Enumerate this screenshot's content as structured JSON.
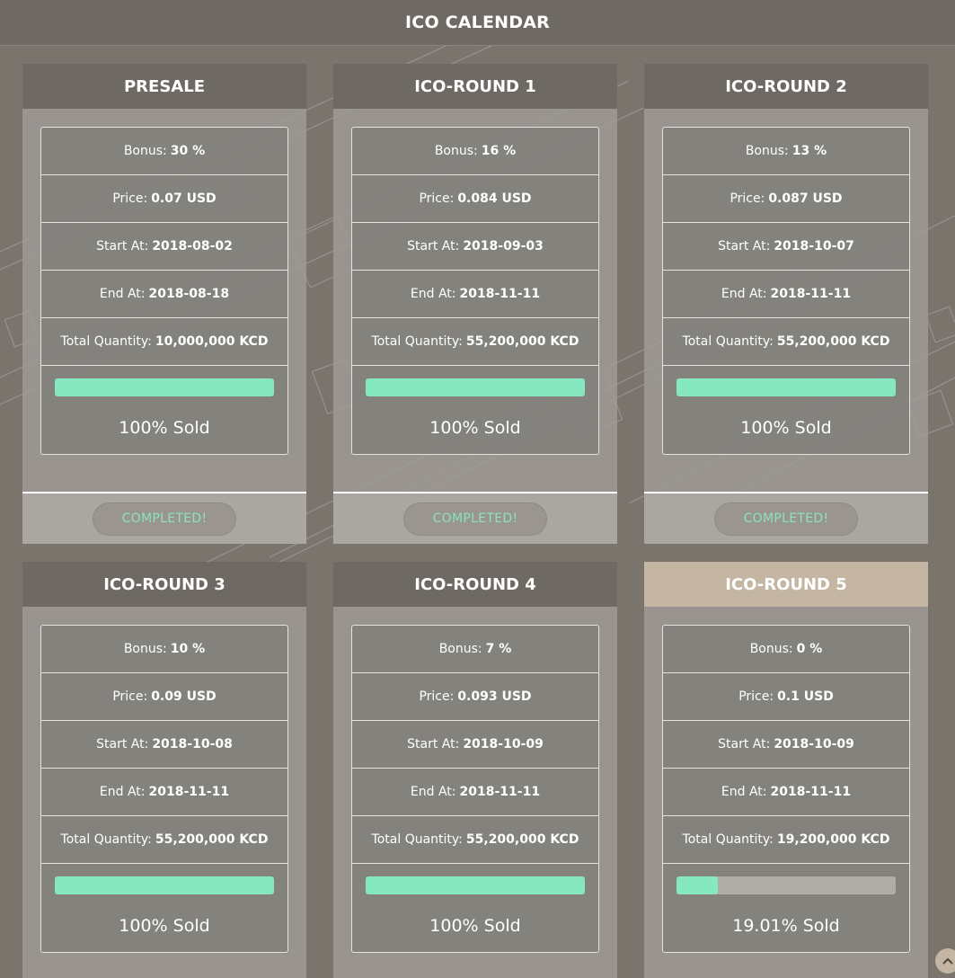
{
  "header": {
    "title": "ICO CALENDAR"
  },
  "labels": {
    "bonus": "Bonus:",
    "price": "Price:",
    "start": "Start At:",
    "end": "End At:",
    "quantity": "Total Quantity:"
  },
  "colors": {
    "accent_green": "#86e8c0",
    "header_dark": "#6e6962",
    "header_active": "#c4b6a2",
    "background": "#7a746d"
  },
  "scroll_top_icon": "chevron-up-icon",
  "rounds": [
    {
      "title": "PRESALE",
      "bonus": "30 %",
      "price": "0.07 USD",
      "start": "2018-08-02",
      "end": "2018-08-18",
      "quantity": "10,000,000 KCD",
      "progress": 100,
      "sold_label": "100% Sold",
      "status": "COMPLETED!"
    },
    {
      "title": "ICO-ROUND 1",
      "bonus": "16 %",
      "price": "0.084 USD",
      "start": "2018-09-03",
      "end": "2018-11-11",
      "quantity": "55,200,000 KCD",
      "progress": 100,
      "sold_label": "100% Sold",
      "status": "COMPLETED!"
    },
    {
      "title": "ICO-ROUND 2",
      "bonus": "13 %",
      "price": "0.087 USD",
      "start": "2018-10-07",
      "end": "2018-11-11",
      "quantity": "55,200,000 KCD",
      "progress": 100,
      "sold_label": "100% Sold",
      "status": "COMPLETED!"
    },
    {
      "title": "ICO-ROUND 3",
      "bonus": "10 %",
      "price": "0.09 USD",
      "start": "2018-10-08",
      "end": "2018-11-11",
      "quantity": "55,200,000 KCD",
      "progress": 100,
      "sold_label": "100% Sold"
    },
    {
      "title": "ICO-ROUND 4",
      "bonus": "7 %",
      "price": "0.093 USD",
      "start": "2018-10-09",
      "end": "2018-11-11",
      "quantity": "55,200,000 KCD",
      "progress": 100,
      "sold_label": "100% Sold"
    },
    {
      "title": "ICO-ROUND 5",
      "bonus": "0 %",
      "price": "0.1 USD",
      "start": "2018-10-09",
      "end": "2018-11-11",
      "quantity": "19,200,000 KCD",
      "progress": 19.01,
      "sold_label": "19.01% Sold",
      "active": true
    }
  ]
}
